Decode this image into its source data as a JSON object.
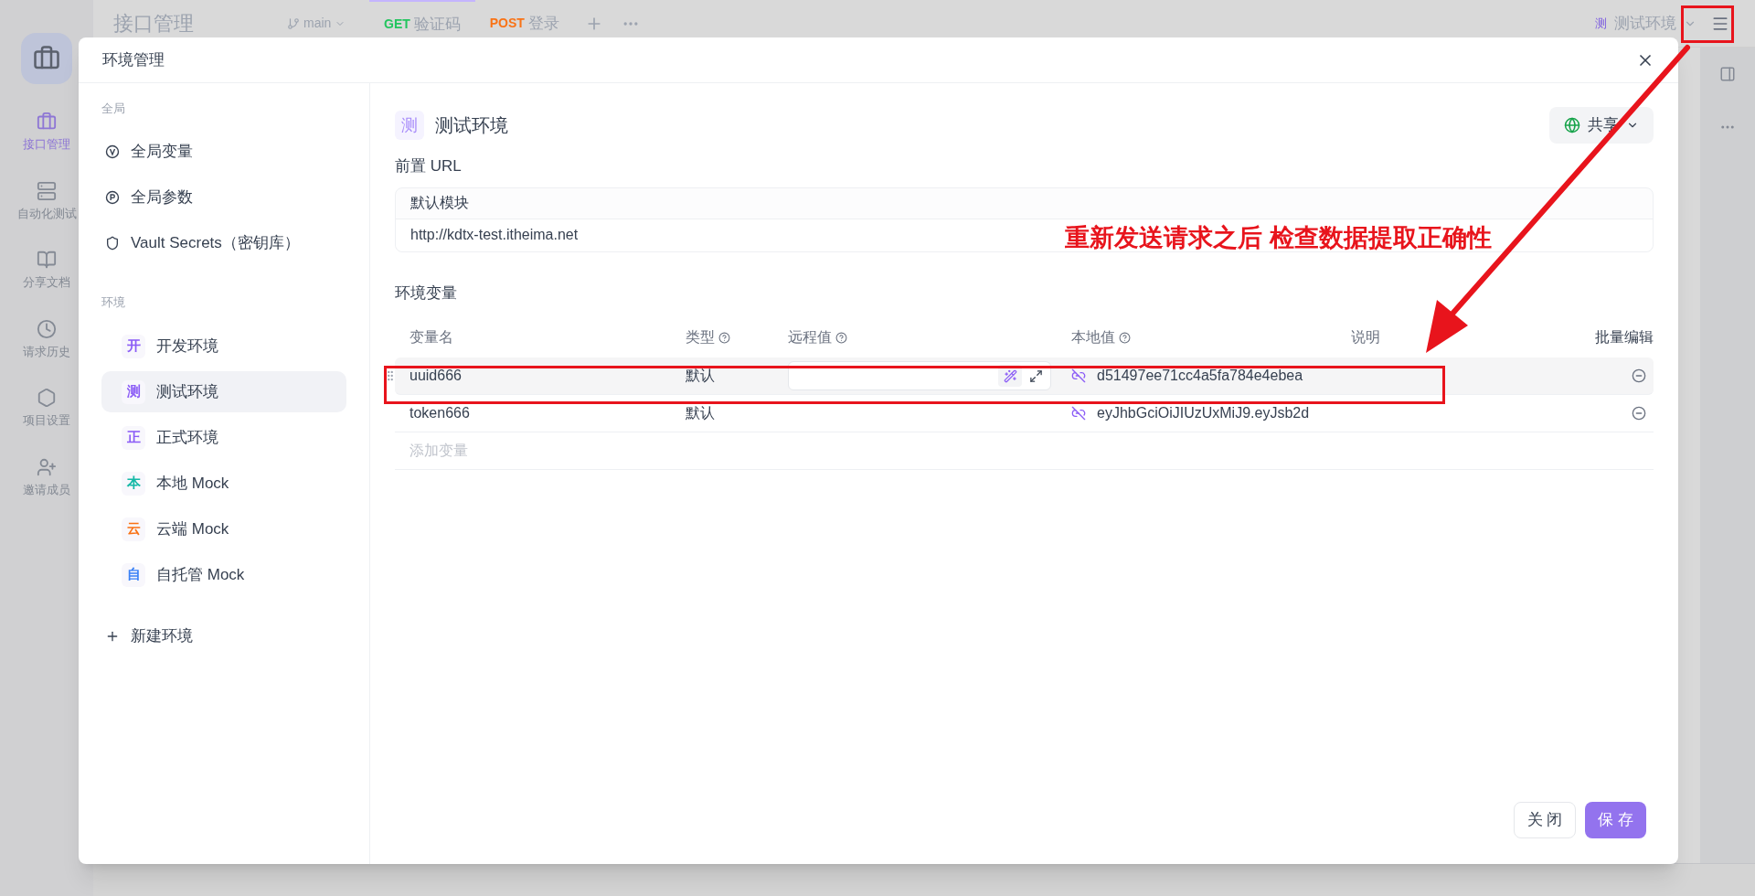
{
  "background": {
    "rail": [
      {
        "label": "接口管理",
        "selected": true
      },
      {
        "label": "自动化测试",
        "selected": false
      },
      {
        "label": "分享文档",
        "selected": false
      },
      {
        "label": "请求历史",
        "selected": false
      },
      {
        "label": "项目设置",
        "selected": false
      },
      {
        "label": "邀请成员",
        "selected": false
      }
    ],
    "project_title": "接口管理",
    "branch": "main",
    "tabs": [
      {
        "method": "GET",
        "label": "验证码",
        "color": "#22c55e",
        "selected": true
      },
      {
        "method": "POST",
        "label": "登录",
        "color": "#f97316",
        "selected": false
      }
    ],
    "env_select": {
      "badge": "测",
      "label": "测试环境"
    }
  },
  "dialog": {
    "title": "环境管理",
    "sidebar": {
      "global_heading": "全局",
      "global_items": [
        {
          "kind": "variable",
          "label": "全局变量"
        },
        {
          "kind": "parameter",
          "label": "全局参数"
        },
        {
          "kind": "secret",
          "label": "Vault Secrets（密钥库）"
        }
      ],
      "env_heading": "环境",
      "environments": [
        {
          "badge": "开",
          "label": "开发环境",
          "color": "#8b5cf6",
          "selected": false
        },
        {
          "badge": "测",
          "label": "测试环境",
          "color": "#8b5cf6",
          "selected": true
        },
        {
          "badge": "正",
          "label": "正式环境",
          "color": "#8b5cf6",
          "selected": false
        },
        {
          "badge": "本",
          "label": "本地 Mock",
          "color": "#14b8a6",
          "selected": false
        },
        {
          "badge": "云",
          "label": "云端 Mock",
          "color": "#f97316",
          "selected": false
        },
        {
          "badge": "自",
          "label": "自托管 Mock",
          "color": "#3b82f6",
          "selected": false
        }
      ],
      "new_env": "新建环境"
    },
    "env": {
      "badge": "测",
      "name": "测试环境",
      "share": "共享"
    },
    "base_url": {
      "heading": "前置 URL",
      "module": "默认模块",
      "url": "http://kdtx-test.itheima.net"
    },
    "variables": {
      "heading": "环境变量",
      "columns": [
        "变量名",
        "类型",
        "远程值",
        "本地值",
        "说明"
      ],
      "bulk_edit": "批量编辑",
      "rows": [
        {
          "name": "uuid666",
          "type": "默认",
          "local": "d51497ee71cc4a5fa784e4ebea",
          "editing": true
        },
        {
          "name": "token666",
          "type": "默认",
          "local": "eyJhbGciOiJIUzUxMiJ9.eyJsb2d",
          "editing": false
        }
      ],
      "add_placeholder": "添加变量"
    },
    "buttons": [
      "关 闭",
      "保 存"
    ]
  },
  "annotation": {
    "text": "重新发送请求之后 检查数据提取正确性"
  }
}
